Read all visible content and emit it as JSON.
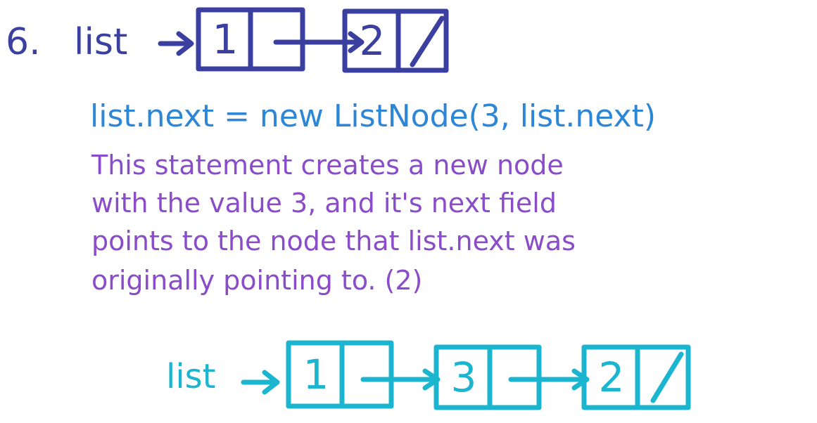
{
  "problem_number": "6.",
  "before": {
    "list_label": "list",
    "nodes": [
      {
        "value": "1",
        "next": "-"
      },
      {
        "value": "2",
        "next": "/"
      }
    ],
    "color": "#3a3fa0"
  },
  "statement": "list.next = new ListNode(3, list.next)",
  "explanation": [
    "This statement creates a new node",
    "with the value 3, and it's next field",
    "points to the node that list.next was",
    "originally pointing to. (2)"
  ],
  "after": {
    "list_label": "list",
    "nodes": [
      {
        "value": "1",
        "next": "-"
      },
      {
        "value": "3",
        "next": "-"
      },
      {
        "value": "2",
        "next": "/"
      }
    ],
    "color": "#1cb5cf"
  },
  "colors": {
    "before": "#3a3fa0",
    "statement": "#2e86d6",
    "explanation": "#8a4cc8",
    "after": "#1cb5cf"
  }
}
